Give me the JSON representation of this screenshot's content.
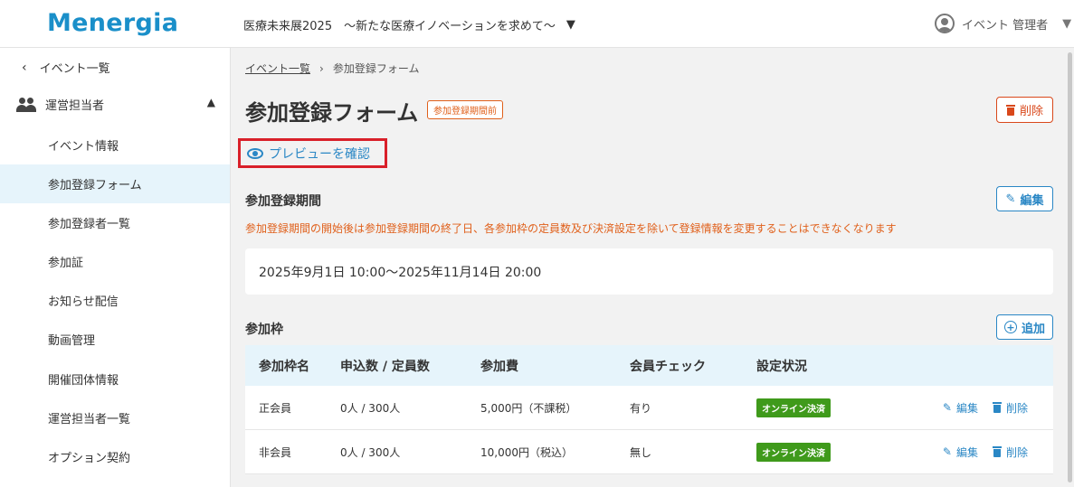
{
  "header": {
    "logo": "Menergia",
    "event_name": "医療未来展2025　～新たな医療イノベーションを求めて～",
    "user_name": "イベント 管理者"
  },
  "sidebar": {
    "back_label": "イベント一覧",
    "group_label": "運営担当者",
    "items": [
      {
        "label": "イベント情報"
      },
      {
        "label": "参加登録フォーム"
      },
      {
        "label": "参加登録者一覧"
      },
      {
        "label": "参加証"
      },
      {
        "label": "お知らせ配信"
      },
      {
        "label": "動画管理"
      },
      {
        "label": "開催団体情報"
      },
      {
        "label": "運営担当者一覧"
      },
      {
        "label": "オプション契約"
      }
    ]
  },
  "breadcrumb": {
    "parent": "イベント一覧",
    "separator": "›",
    "current": "参加登録フォーム"
  },
  "page": {
    "title": "参加登録フォーム",
    "status_badge": "参加登録期間前",
    "delete_label": "削除",
    "preview_label": "プレビューを確認"
  },
  "registration_period": {
    "title": "参加登録期間",
    "edit_label": "編集",
    "warning": "参加登録期間の開始後は参加登録期間の終了日、各参加枠の定員数及び決済設定を除いて登録情報を変更することはできなくなります",
    "value": "2025年9月1日 10:00～2025年11月14日 20:00"
  },
  "slots": {
    "title": "参加枠",
    "add_label": "追加",
    "columns": [
      "参加枠名",
      "申込数 / 定員数",
      "参加費",
      "会員チェック",
      "設定状況"
    ],
    "rows": [
      {
        "name": "正会員",
        "count": "0人 / 300人",
        "fee": "5,000円（不課税）",
        "member_check": "有り",
        "status": "オンライン決済",
        "edit": "編集",
        "delete": "削除"
      },
      {
        "name": "非会員",
        "count": "0人 / 300人",
        "fee": "10,000円（税込）",
        "member_check": "無し",
        "status": "オンライン決済",
        "edit": "編集",
        "delete": "削除"
      }
    ]
  },
  "colors": {
    "brand": "#1a8fc9",
    "accent": "#2a87c5",
    "warning": "#e0601b",
    "danger": "#d9481b",
    "success_badge": "#3f9a1b",
    "highlight_box": "#d9202a"
  }
}
